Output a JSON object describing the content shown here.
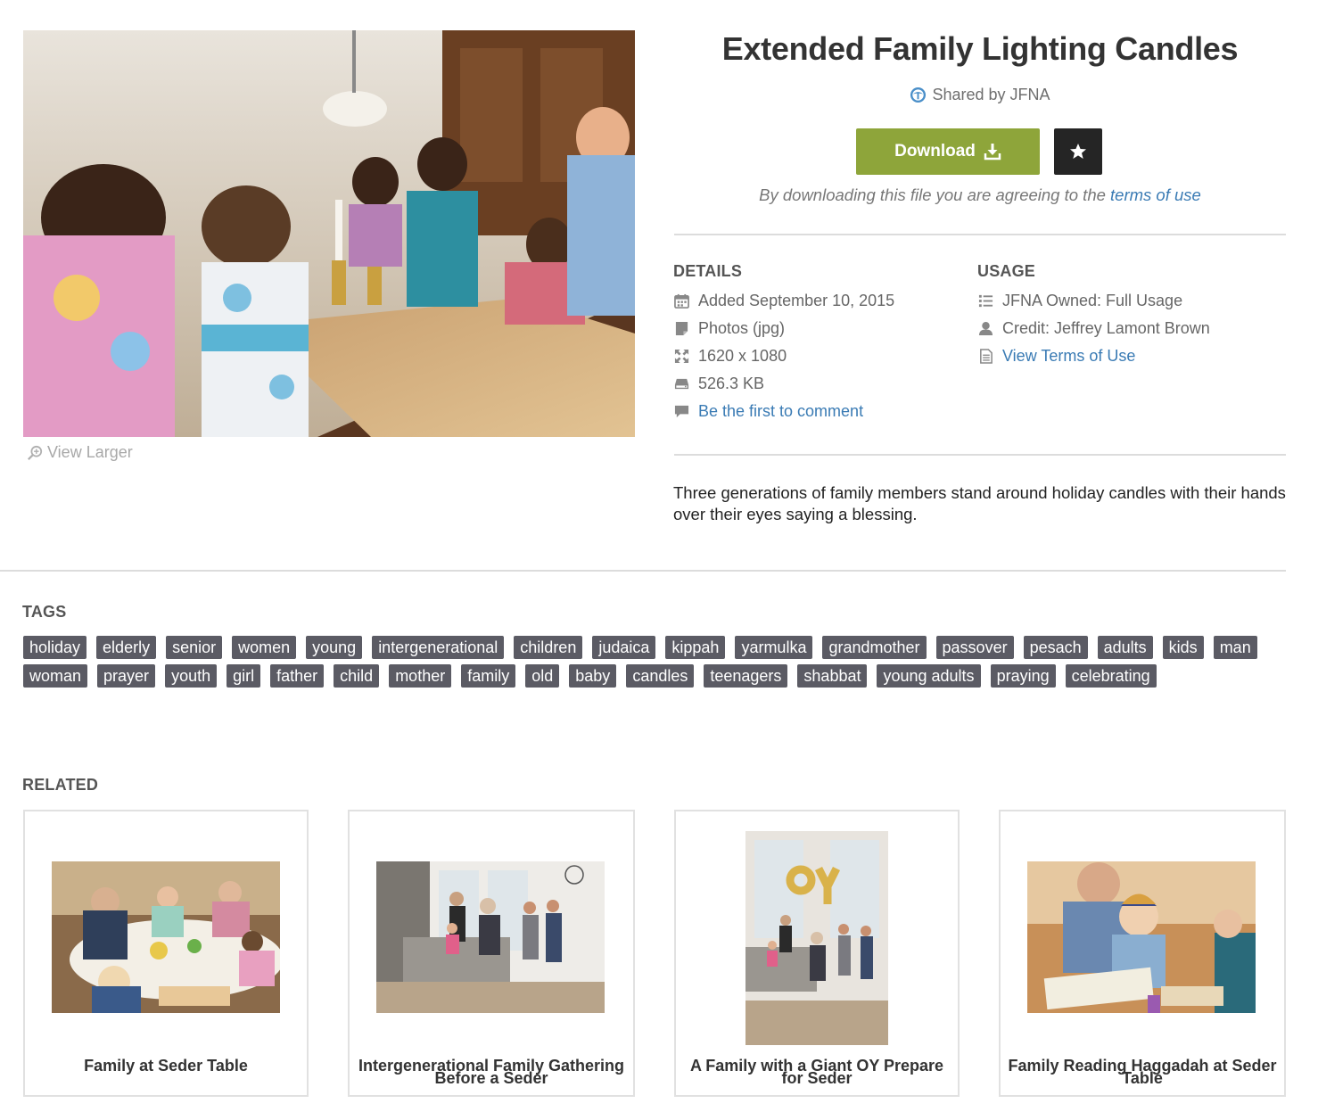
{
  "photo": {
    "view_larger": "View Larger"
  },
  "header": {
    "title": "Extended Family Lighting Candles",
    "shared_by": "Shared by JFNA",
    "download_label": "Download",
    "agree_text": "By downloading this file you are agreeing to the ",
    "terms_link": "terms of use"
  },
  "details": {
    "heading": "DETAILS",
    "items": [
      {
        "icon": "calendar-icon",
        "text": "Added September 10, 2015"
      },
      {
        "icon": "file-icon",
        "text": "Photos (jpg)"
      },
      {
        "icon": "dimensions-icon",
        "text": "1620 x 1080"
      },
      {
        "icon": "disk-icon",
        "text": "526.3 KB"
      },
      {
        "icon": "comment-icon",
        "text": "Be the first to comment"
      }
    ]
  },
  "usage": {
    "heading": "USAGE",
    "items": [
      {
        "icon": "list-icon",
        "text": "JFNA Owned: Full Usage"
      },
      {
        "icon": "user-icon",
        "text": "Credit: Jeffrey Lamont Brown"
      },
      {
        "icon": "document-icon",
        "text": "View Terms of Use"
      }
    ]
  },
  "description": "Three generations of family members stand around holiday candles with their hands over their eyes saying a blessing.",
  "tags": {
    "heading": "TAGS",
    "items": [
      "holiday",
      "elderly",
      "senior",
      "women",
      "young",
      "intergenerational",
      "children",
      "judaica",
      "kippah",
      "yarmulka",
      "grandmother",
      "passover",
      "pesach",
      "adults",
      "kids",
      "man",
      "woman",
      "prayer",
      "youth",
      "girl",
      "father",
      "child",
      "mother",
      "family",
      "old",
      "baby",
      "candles",
      "teenagers",
      "shabbat",
      "young adults",
      "praying",
      "celebrating"
    ]
  },
  "related": {
    "heading": "RELATED",
    "items": [
      {
        "title": "Family at Seder Table"
      },
      {
        "title": "Intergenerational Family Gathering Before a Seder"
      },
      {
        "title": "A Family with a Giant OY Prepare for Seder"
      },
      {
        "title": "Family Reading Haggadah at Seder Table"
      }
    ]
  },
  "colors": {
    "download_green": "#8ea53a",
    "star_button": "#252525",
    "link_blue": "#3a7bb4",
    "tag_bg": "#5b5b64"
  }
}
